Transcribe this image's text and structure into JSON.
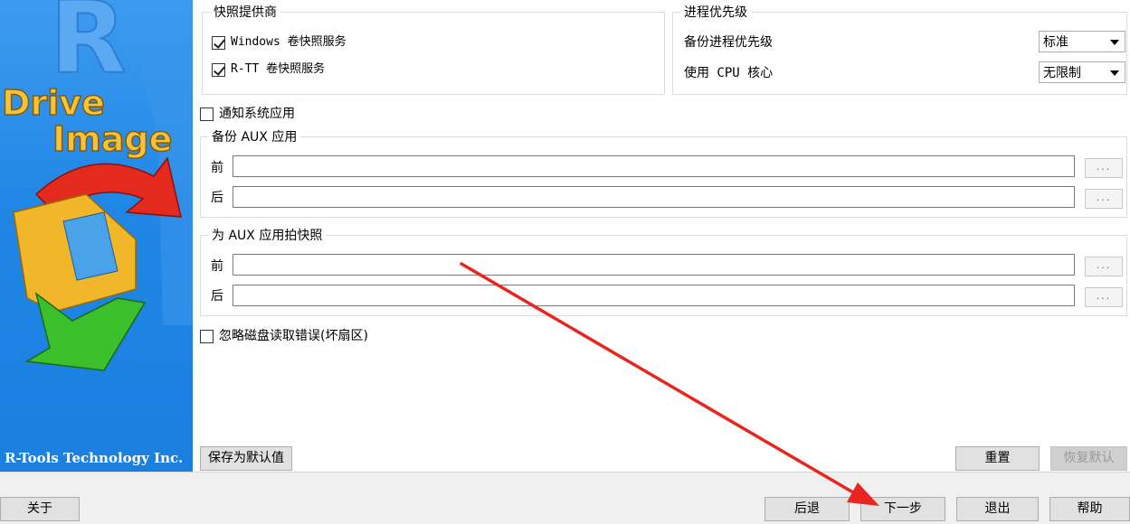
{
  "brand": {
    "logo_letter": "R",
    "word1": "Drive",
    "word2": "Image",
    "footer": "R-Tools Technology Inc."
  },
  "snapshot_provider": {
    "title": "快照提供商",
    "options": [
      {
        "label": "Windows 卷快照服务",
        "checked": true
      },
      {
        "label": "R-TT 卷快照服务",
        "checked": true
      }
    ]
  },
  "process_priority": {
    "title": "进程优先级",
    "backup_priority_label": "备份进程优先级",
    "backup_priority_value": "标准",
    "cpu_cores_label": "使用 CPU 核心",
    "cpu_cores_value": "无限制"
  },
  "notify_apps": {
    "label": "通知系统应用",
    "checked": false
  },
  "backup_aux": {
    "title": "备份 AUX 应用",
    "before_label": "前",
    "after_label": "后",
    "browse_label": "..."
  },
  "snapshot_aux": {
    "title": "为 AUX 应用拍快照",
    "before_label": "前",
    "after_label": "后",
    "browse_label": "..."
  },
  "ignore_errors": {
    "label": "忽略磁盘读取错误(坏扇区)",
    "checked": false
  },
  "buttons": {
    "save_default": "保存为默认值",
    "reset": "重置",
    "restore_default": "恢复默认",
    "about": "关于",
    "back": "后退",
    "next": "下一步",
    "exit": "退出",
    "help": "帮助"
  },
  "colors": {
    "brand_blue": "#1f86e6",
    "annotation_arrow": "#e8261f"
  }
}
